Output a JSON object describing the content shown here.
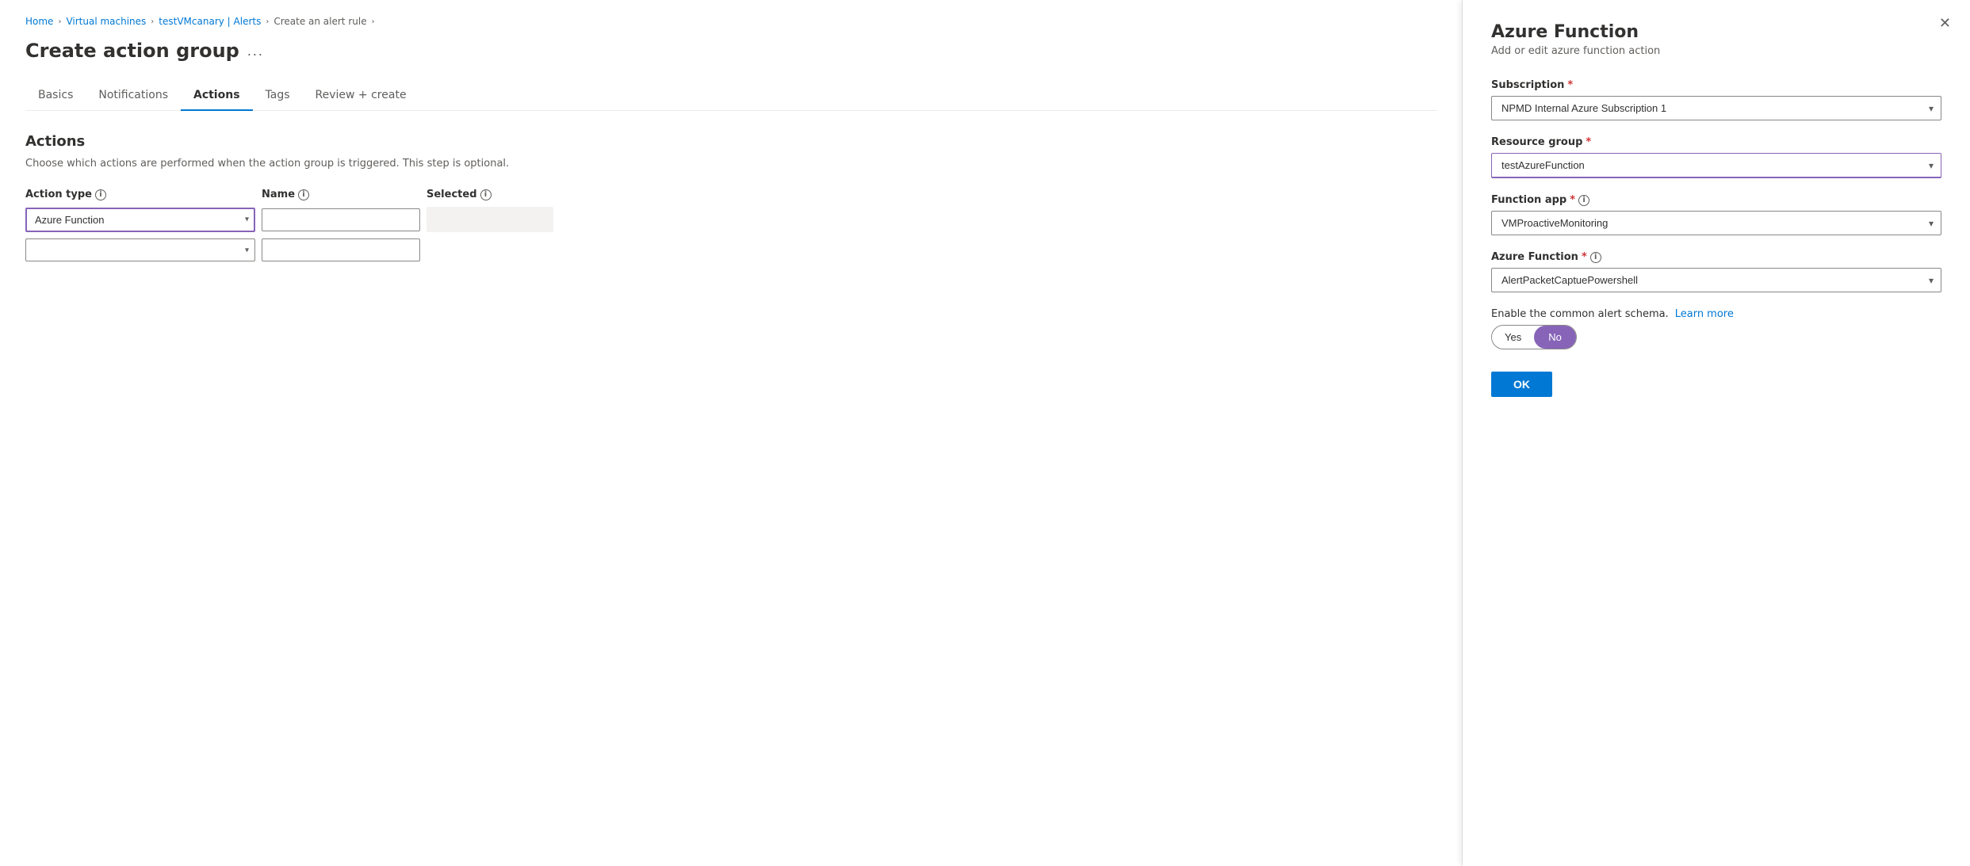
{
  "breadcrumb": {
    "items": [
      {
        "label": "Home",
        "href": "#"
      },
      {
        "label": "Virtual machines",
        "href": "#"
      },
      {
        "label": "testVMcanary | Alerts",
        "href": "#"
      },
      {
        "label": "Create an alert rule",
        "href": "#"
      }
    ]
  },
  "page": {
    "title": "Create action group",
    "ellipsis": "..."
  },
  "tabs": [
    {
      "label": "Basics",
      "active": false
    },
    {
      "label": "Notifications",
      "active": false
    },
    {
      "label": "Actions",
      "active": true
    },
    {
      "label": "Tags",
      "active": false
    },
    {
      "label": "Review + create",
      "active": false
    }
  ],
  "actions_section": {
    "title": "Actions",
    "description": "Choose which actions are performed when the action group is triggered. This step is optional."
  },
  "table": {
    "headers": {
      "action_type": "Action type",
      "name": "Name",
      "selected": "Selected"
    },
    "rows": [
      {
        "action_type_value": "Azure Function",
        "name_value": "",
        "selected_value": ""
      },
      {
        "action_type_value": "",
        "name_value": "",
        "selected_value": ""
      }
    ]
  },
  "right_panel": {
    "title": "Azure Function",
    "subtitle": "Add or edit azure function action",
    "subscription_label": "Subscription",
    "subscription_value": "NPMD Internal Azure Subscription 1",
    "resource_group_label": "Resource group",
    "resource_group_value": "testAzureFunction",
    "function_app_label": "Function app",
    "function_app_value": "VMProactiveMonitoring",
    "azure_function_label": "Azure Function",
    "azure_function_value": "AlertPacketCaptuePowershell",
    "enable_schema_label": "Enable the common alert schema.",
    "learn_more_label": "Learn more",
    "toggle_yes": "Yes",
    "toggle_no": "No",
    "ok_label": "OK",
    "close_label": "✕"
  }
}
